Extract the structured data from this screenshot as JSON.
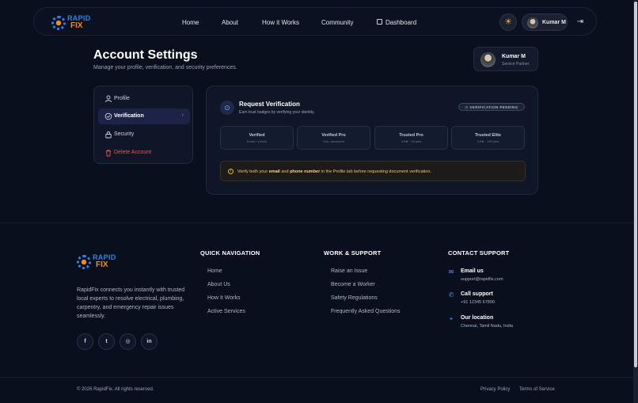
{
  "brand": {
    "logo_top": "RAPID",
    "logo_bottom": "FIX",
    "colors": {
      "blue": "#2b83e3",
      "orange": "#f08a24"
    }
  },
  "nav": {
    "links": [
      "Home",
      "About",
      "How it Works",
      "Community"
    ],
    "dashboard": "Dashboard",
    "user_name": "Kumar M"
  },
  "page": {
    "title": "Account Settings",
    "subtitle": "Manage your profile, verification, and security preferences."
  },
  "profile_card": {
    "name": "Kumar M",
    "role": "Service Partner"
  },
  "sidebar": {
    "items": [
      {
        "label": "Profile",
        "icon": "user-icon"
      },
      {
        "label": "Verification",
        "icon": "check-circle-icon",
        "active": true
      },
      {
        "label": "Security",
        "icon": "lock-icon"
      },
      {
        "label": "Delete Account",
        "icon": "trash-icon",
        "danger": true
      }
    ]
  },
  "verification": {
    "title": "Request Verification",
    "subtitle": "Earn trust badges by verifying your identity.",
    "badge": "VERIFICATION PENDING",
    "tiers": [
      {
        "name": "Verified",
        "desc": "Email + phone"
      },
      {
        "name": "Verified Pro",
        "desc": "Gov. document"
      },
      {
        "name": "Trusted Pro",
        "desc": "4.5★ · 20 jobs"
      },
      {
        "name": "Trusted Elite",
        "desc": "4.8★ · 100 jobs"
      }
    ],
    "warning": {
      "pre": "Verify both your ",
      "email": "email",
      "mid": " and ",
      "phone": "phone number",
      "post": " in the Profile tab before requesting document verification."
    }
  },
  "footer": {
    "description": "RapidFix connects you instantly with trusted local experts to resolve electrical, plumbing, carpentry, and emergency repair issues seamlessly.",
    "quick_nav": {
      "heading": "QUICK NAVIGATION",
      "links": [
        "Home",
        "About Us",
        "How It Works",
        "Active Services"
      ]
    },
    "work_support": {
      "heading": "WORK & SUPPORT",
      "links": [
        "Raise an Issue",
        "Become a Worker",
        "Safety Regulations",
        "Frequently Asked Questions"
      ]
    },
    "contact": {
      "heading": "CONTACT SUPPORT",
      "items": [
        {
          "title": "Email us",
          "value": "support@rapidfix.com",
          "icon": "mail-icon"
        },
        {
          "title": "Call support",
          "value": "+91 12345 67890",
          "icon": "phone-icon"
        },
        {
          "title": "Our location",
          "value": "Chennai, Tamil Nadu, India",
          "icon": "map-pin-icon"
        }
      ]
    },
    "socials": [
      {
        "icon": "facebook-icon",
        "glyph": "f"
      },
      {
        "icon": "twitter-icon",
        "glyph": "t"
      },
      {
        "icon": "instagram-icon",
        "glyph": "◎"
      },
      {
        "icon": "linkedin-icon",
        "glyph": "in"
      }
    ],
    "copyright": "© 2026 RapidFix. All rights reserved.",
    "privacy": "Privacy Policy",
    "terms": "Terms of Service"
  }
}
